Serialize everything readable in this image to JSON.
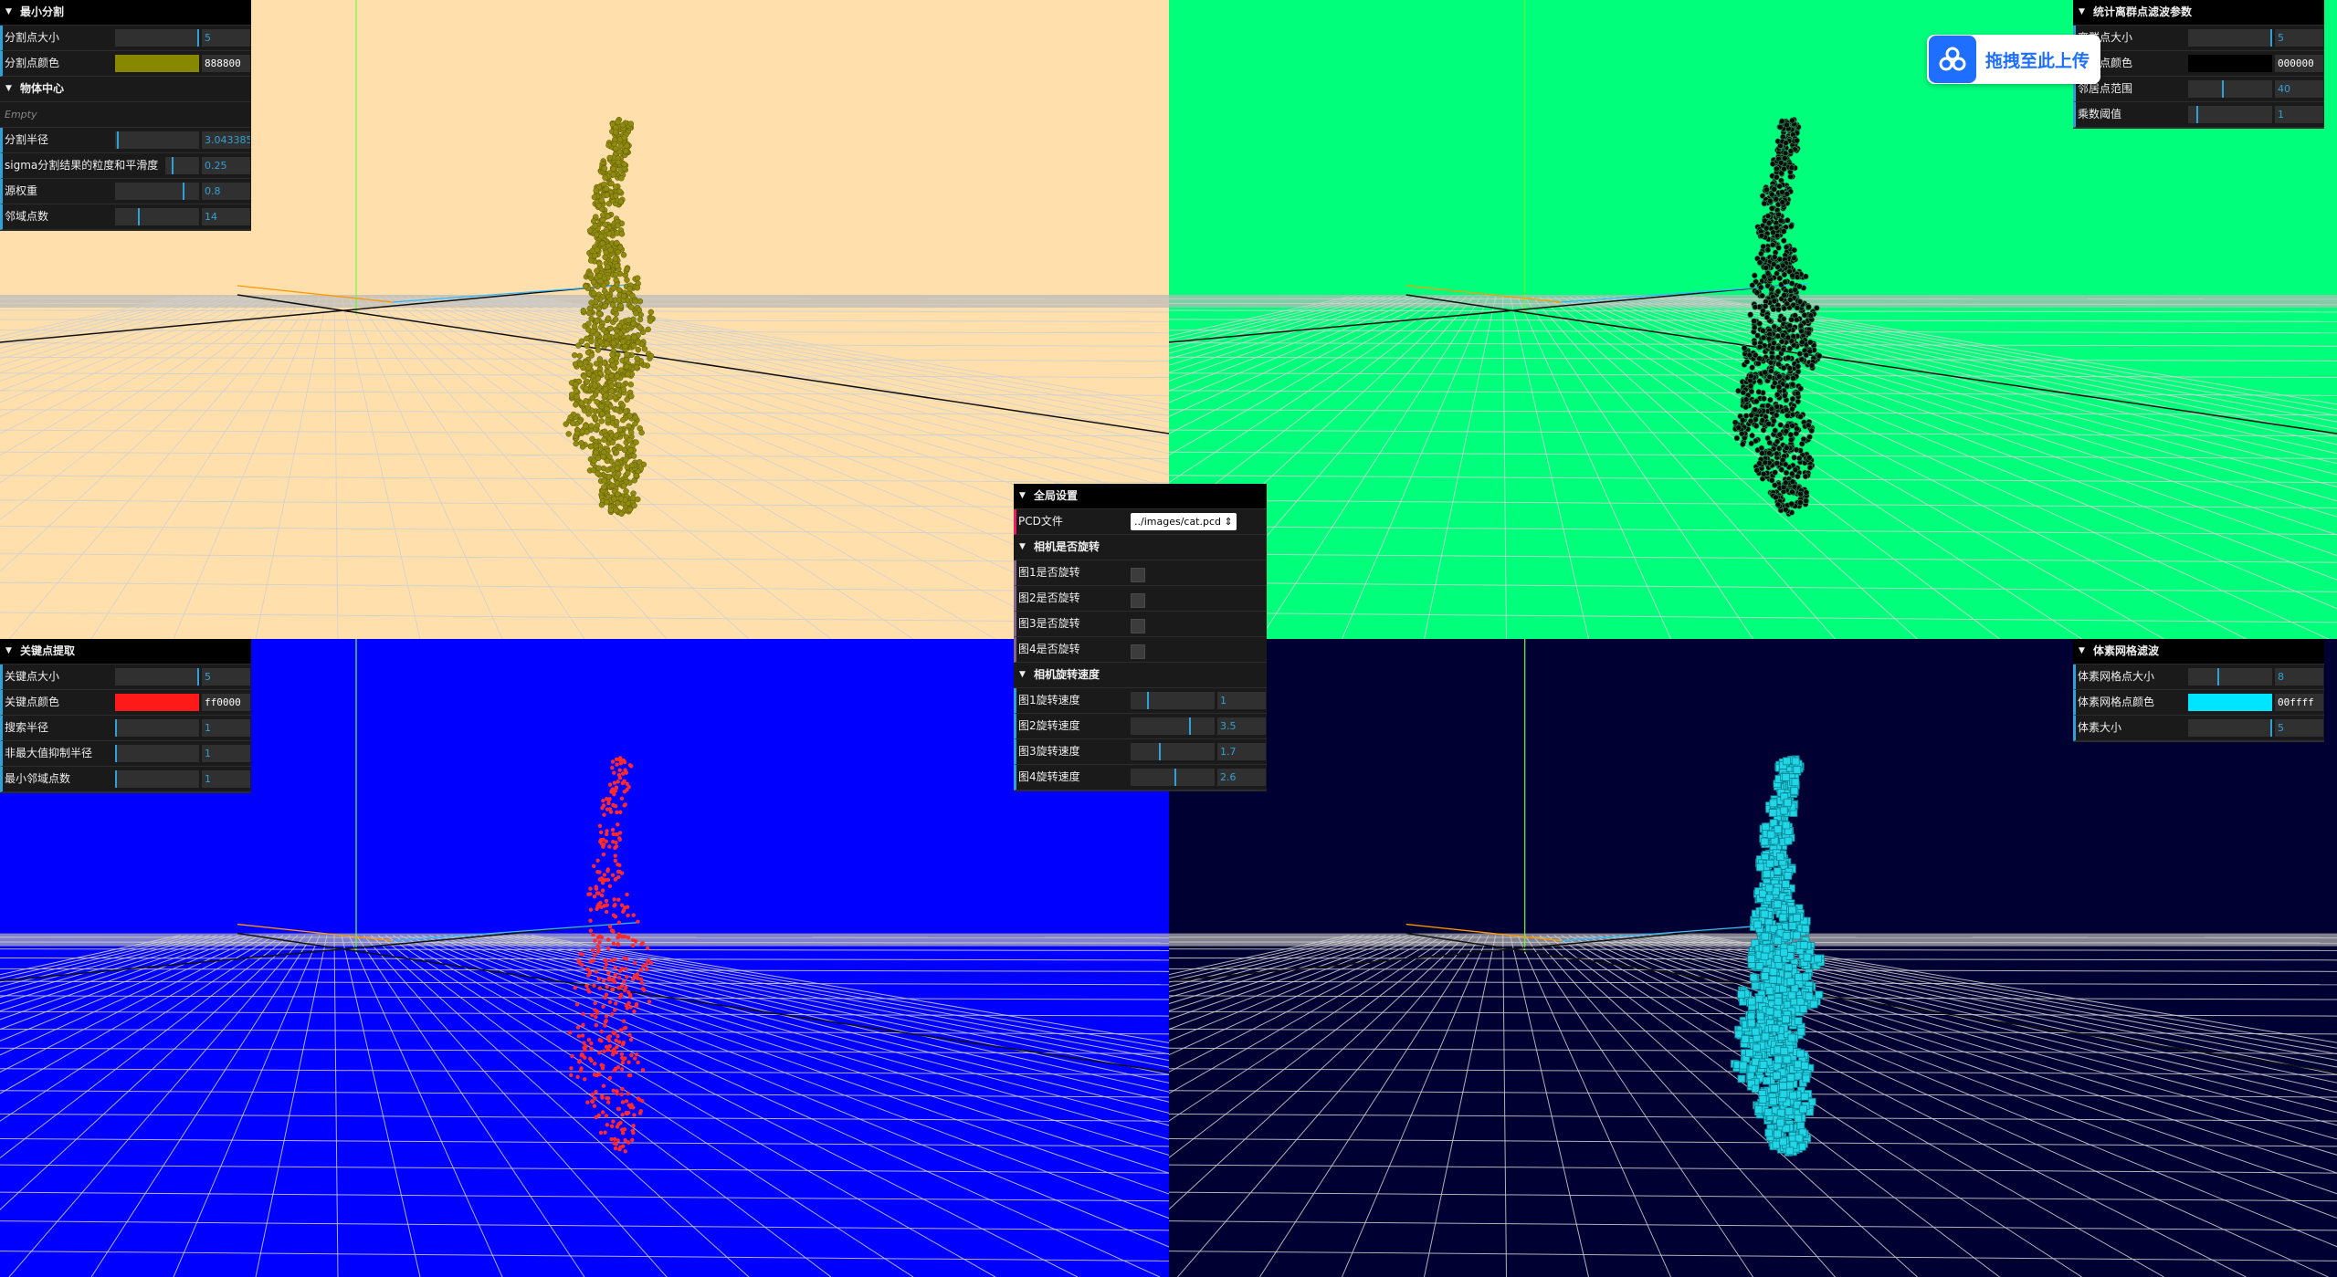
{
  "panels": {
    "min_cut": {
      "title": "最小分割",
      "point_size_label": "分割点大小",
      "point_size_value": "5",
      "point_size_fraction": 1.0,
      "point_color_label": "分割点颜色",
      "point_color_hex": "888800",
      "point_color_css": "#888800",
      "object_center_title": "物体中心",
      "empty_text": "Empty",
      "radius_label": "分割半径",
      "radius_value": "3.0433856",
      "radius_fraction": 0.02,
      "sigma_label": "sigma分割结果的粒度和平滑度",
      "sigma_value": "0.25",
      "sigma_fraction": 0.2,
      "source_weight_label": "源权重",
      "source_weight_value": "0.8",
      "source_weight_fraction": 0.8,
      "neighbors_label": "邻域点数",
      "neighbors_value": "14",
      "neighbors_fraction": 0.27
    },
    "sor": {
      "title": "统计离群点滤波参数",
      "point_size_label": "离群点大小",
      "point_size_value": "5",
      "point_size_fraction": 1.0,
      "point_color_label": "离群点颜色",
      "point_color_hex": "000000",
      "point_color_css": "#000000",
      "neighbor_range_label": "邻居点范围",
      "neighbor_range_value": "40",
      "neighbor_range_fraction": 0.4,
      "multiplier_label": "乘数阈值",
      "multiplier_value": "1",
      "multiplier_fraction": 0.1
    },
    "keypoints": {
      "title": "关键点提取",
      "point_size_label": "关键点大小",
      "point_size_value": "5",
      "point_size_fraction": 1.0,
      "point_color_label": "关键点颜色",
      "point_color_hex": "ff0000",
      "point_color_css": "#ff1a1a",
      "search_radius_label": "搜索半径",
      "search_radius_value": "1",
      "search_radius_fraction": 0.0,
      "nms_radius_label": "非最大值抑制半径",
      "nms_radius_value": "1",
      "nms_radius_fraction": 0.0,
      "min_neighbors_label": "最小邻域点数",
      "min_neighbors_value": "1",
      "min_neighbors_fraction": 0.0
    },
    "voxel": {
      "title": "体素网格滤波",
      "grid_size_label": "体素网格点大小",
      "grid_size_value": "8",
      "grid_size_fraction": 0.35,
      "grid_color_label": "体素网格点颜色",
      "grid_color_hex": "00ffff",
      "grid_color_css": "#00e5ff",
      "voxel_size_label": "体素大小",
      "voxel_size_value": "5",
      "voxel_size_fraction": 1.0
    },
    "global": {
      "title": "全局设置",
      "pcd_label": "PCD文件",
      "pcd_value": "../images/cat.pcd",
      "rotate_title": "相机是否旋转",
      "rotate1_label": "图1是否旋转",
      "rotate2_label": "图2是否旋转",
      "rotate3_label": "图3是否旋转",
      "rotate4_label": "图4是否旋转",
      "speed_title": "相机旋转速度",
      "speed1_label": "图1旋转速度",
      "speed1_value": "1",
      "speed1_fraction": 0.2,
      "speed2_label": "图2旋转速度",
      "speed2_value": "3.5",
      "speed2_fraction": 0.7,
      "speed3_label": "图3旋转速度",
      "speed3_value": "1.7",
      "speed3_fraction": 0.34,
      "speed4_label": "图4旋转速度",
      "speed4_value": "2.6",
      "speed4_fraction": 0.52
    }
  },
  "upload": {
    "label": "拖拽至此上传"
  },
  "viewports": {
    "q1_bg": "#ffe0ad",
    "q1_cloud": "#8f8a10",
    "q2_bg": "#00ff7b",
    "q2_cloud": "#0a0a0a",
    "q3_bg": "#0000ff",
    "q3_cloud": "#ff2a2a",
    "q4_bg": "#000033",
    "q4_cloud": "#22d8e8"
  }
}
